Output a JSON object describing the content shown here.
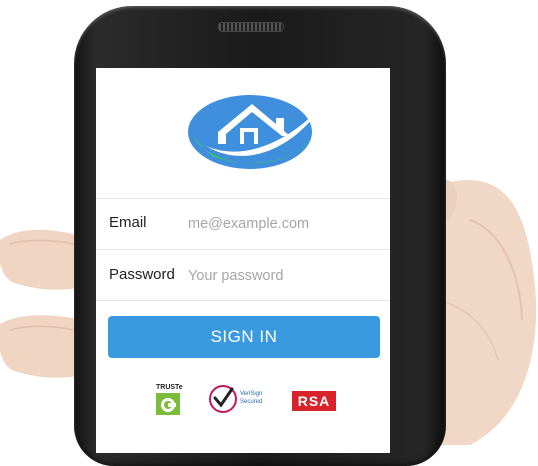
{
  "login_form": {
    "email_label": "Email",
    "email_placeholder": "me@example.com",
    "password_label": "Password",
    "password_placeholder": "Your password",
    "sign_in_label": "SIGN IN"
  },
  "trust_badges": {
    "truste": "TRUSTe",
    "verisign_line1": "VeriSign",
    "verisign_line2": "Secured",
    "rsa": "RSA"
  },
  "colors": {
    "accent_blue": "#3a9ae0",
    "logo_blue": "#3f8fdc",
    "logo_green": "#37c46a",
    "rsa_red": "#d8232a"
  },
  "icons": {
    "logo": "house-swoosh-logo",
    "truste": "truste-badge-icon",
    "verisign": "verisign-check-icon"
  }
}
